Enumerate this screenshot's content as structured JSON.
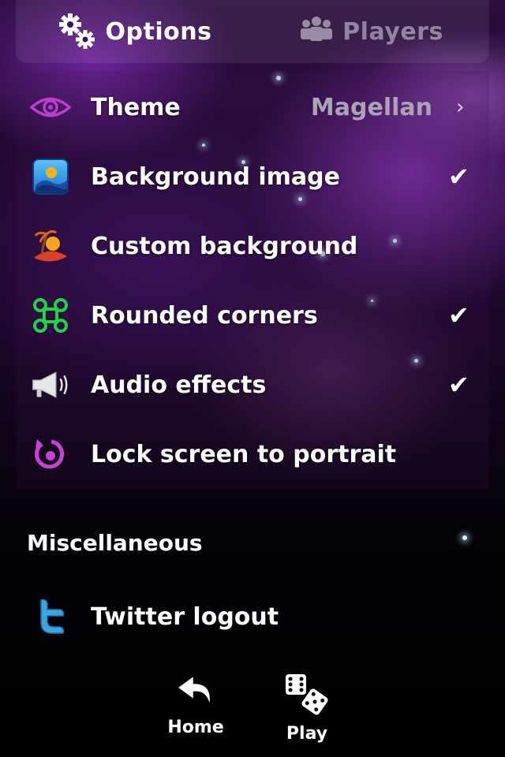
{
  "tabs": [
    {
      "label": "Options",
      "icon": "gears-icon",
      "active": true
    },
    {
      "label": "Players",
      "icon": "people-icon",
      "active": false
    }
  ],
  "settings": [
    {
      "label": "Theme",
      "icon": "eye-icon",
      "value": "Magellan",
      "has_chevron": true,
      "checked": false
    },
    {
      "label": "Background image",
      "icon": "landscape-icon",
      "value": "",
      "has_chevron": false,
      "checked": true
    },
    {
      "label": "Custom background",
      "icon": "palm-island-icon",
      "value": "",
      "has_chevron": false,
      "checked": false
    },
    {
      "label": "Rounded corners",
      "icon": "command-key-icon",
      "value": "",
      "has_chevron": false,
      "checked": true
    },
    {
      "label": "Audio effects",
      "icon": "megaphone-icon",
      "value": "",
      "has_chevron": false,
      "checked": true
    },
    {
      "label": "Lock screen to portrait",
      "icon": "rotate-lock-icon",
      "value": "",
      "has_chevron": false,
      "checked": false
    }
  ],
  "misc": {
    "title": "Miscellaneous",
    "items": [
      {
        "label": "Twitter logout",
        "icon": "twitter-icon"
      }
    ]
  },
  "nav": [
    {
      "label": "Home",
      "icon": "back-arrow-icon"
    },
    {
      "label": "Play",
      "icon": "dice-icon"
    }
  ],
  "glyphs": {
    "chevron": "›",
    "check": "✔"
  },
  "colors": {
    "accent_purple": "#c542d6",
    "eye_purple": "#b93ec9",
    "command_green": "#24d148",
    "twitter_blue": "#3aa6e0"
  }
}
